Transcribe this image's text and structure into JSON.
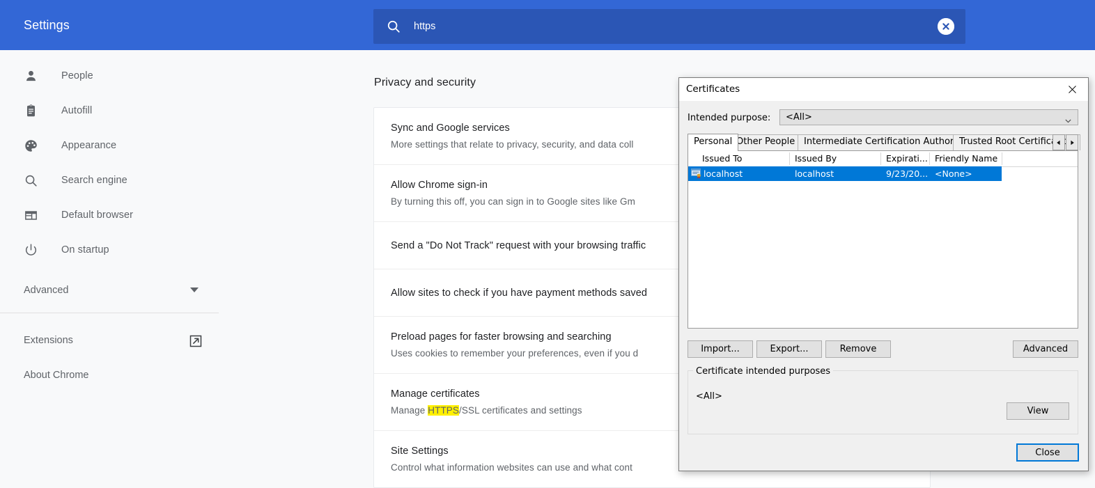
{
  "header": {
    "title": "Settings",
    "search": {
      "icon": "search-icon",
      "value": "https",
      "clear_icon": "close-circle-icon"
    },
    "bar_color": "#3367d6",
    "search_bg": "#2b56b5"
  },
  "sidebar": {
    "items": [
      {
        "label": "People",
        "icon": "person-icon"
      },
      {
        "label": "Autofill",
        "icon": "clipboard-icon"
      },
      {
        "label": "Appearance",
        "icon": "palette-icon"
      },
      {
        "label": "Search engine",
        "icon": "magnifier-icon"
      },
      {
        "label": "Default browser",
        "icon": "browser-window-icon"
      },
      {
        "label": "On startup",
        "icon": "power-icon"
      }
    ],
    "advanced": {
      "label": "Advanced",
      "icon": "chevron-down-icon"
    },
    "extensions": {
      "label": "Extensions",
      "icon": "external-link-icon"
    },
    "about": {
      "label": "About Chrome"
    }
  },
  "main": {
    "section_title": "Privacy and security",
    "rows": [
      {
        "title": "Sync and Google services",
        "sub": "More settings that relate to privacy, security, and data coll"
      },
      {
        "title": "Allow Chrome sign-in",
        "sub": "By turning this off, you can sign in to Google sites like Gm"
      },
      {
        "title": "Send a \"Do Not Track\" request with your browsing traffic",
        "sub": ""
      },
      {
        "title": "Allow sites to check if you have payment methods saved",
        "sub": ""
      },
      {
        "title": "Preload pages for faster browsing and searching",
        "sub": "Uses cookies to remember your preferences, even if you d"
      },
      {
        "title": "Manage certificates",
        "sub_pre": "Manage ",
        "sub_highlight": "HTTPS",
        "sub_post": "/SSL certificates and settings",
        "highlight_color": "#fff000"
      },
      {
        "title": "Site Settings",
        "sub": "Control what information websites can use and what cont"
      }
    ]
  },
  "dialog": {
    "title": "Certificates",
    "close_icon": "close-icon",
    "intended_purpose": {
      "label": "Intended purpose:",
      "value": "<All>",
      "chevron_icon": "chevron-down-icon"
    },
    "tabs": [
      {
        "label": "Personal",
        "active": true
      },
      {
        "label": "Other People",
        "active": false
      },
      {
        "label": "Intermediate Certification Authorities",
        "active": false
      },
      {
        "label": "Trusted Root Certification",
        "active": false
      }
    ],
    "tab_scroll_left_icon": "arrow-left-icon",
    "tab_scroll_right_icon": "arrow-right-icon",
    "table": {
      "columns": [
        "Issued To",
        "Issued By",
        "Expirati...",
        "Friendly Name"
      ],
      "rows": [
        {
          "icon": "certificate-icon",
          "issued_to": "localhost",
          "issued_by": "localhost",
          "expiration": "9/23/20...",
          "friendly_name": "<None>",
          "selected": true
        }
      ],
      "selection_color": "#0078d7"
    },
    "buttons": {
      "import": "Import...",
      "export": "Export...",
      "remove": "Remove",
      "advanced": "Advanced",
      "view": "View",
      "close": "Close"
    },
    "purposes_group": {
      "legend": "Certificate intended purposes",
      "value": "<All>"
    },
    "focus_color": "#0078d7"
  }
}
